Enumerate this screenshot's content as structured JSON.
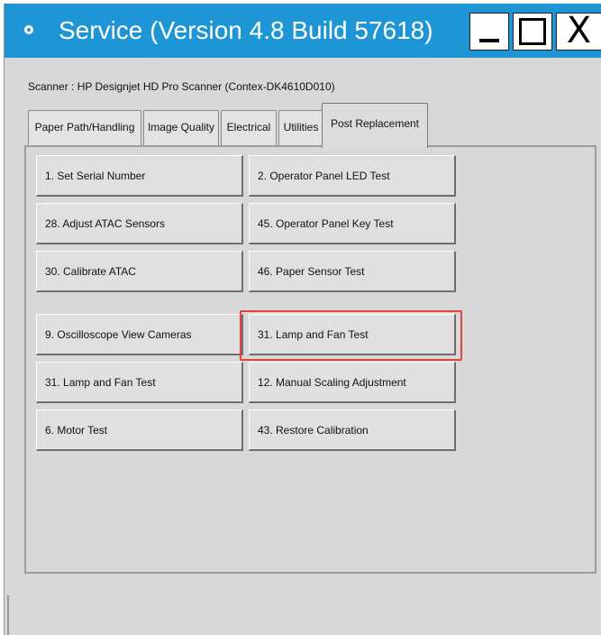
{
  "window": {
    "title": "Service (Version 4.8 Build 57618)",
    "controls": {
      "minimize": "_",
      "maximize": "☐",
      "close": "X"
    }
  },
  "scanner_label": "Scanner : HP Designjet HD Pro Scanner (Contex-DK4610D010)",
  "tabs": [
    {
      "label": "Paper Path/Handling",
      "active": false
    },
    {
      "label": "Image Quality",
      "active": false
    },
    {
      "label": "Electrical",
      "active": false
    },
    {
      "label": "Utilities",
      "active": false
    },
    {
      "label": "Post Replacement",
      "active": true
    }
  ],
  "buttons": {
    "left": [
      "1. Set Serial Number",
      "28. Adjust ATAC Sensors",
      "30. Calibrate ATAC",
      "9. Oscilloscope View Cameras",
      "31. Lamp and Fan Test",
      "6. Motor Test"
    ],
    "right": [
      "2. Operator Panel LED Test",
      "45. Operator Panel Key Test",
      "46. Paper Sensor Test",
      "31. Lamp and Fan Test",
      "12. Manual Scaling Adjustment",
      "43. Restore Calibration"
    ]
  },
  "highlight_color": "#e8413a",
  "title_bar_color": "#1e96d6"
}
